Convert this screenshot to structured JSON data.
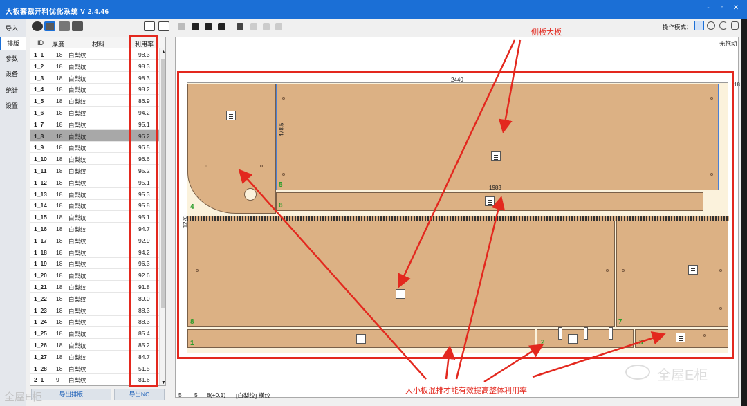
{
  "app": {
    "title": "大板套裁开料优化系统 V 2.4.46",
    "window_buttons": [
      "-",
      "▫",
      "✕"
    ]
  },
  "nav": [
    "导入",
    "排版",
    "参数",
    "设备",
    "统计",
    "设置"
  ],
  "grid": {
    "headers": [
      "ID",
      "厚度",
      "材料",
      "利用率"
    ],
    "rows": [
      [
        "1_1",
        "18",
        "白梨纹",
        "98.3"
      ],
      [
        "1_2",
        "18",
        "白梨纹",
        "98.3"
      ],
      [
        "1_3",
        "18",
        "白梨纹",
        "98.3"
      ],
      [
        "1_4",
        "18",
        "白梨纹",
        "98.2"
      ],
      [
        "1_5",
        "18",
        "白梨纹",
        "86.9"
      ],
      [
        "1_6",
        "18",
        "白梨纹",
        "94.2"
      ],
      [
        "1_7",
        "18",
        "白梨纹",
        "95.1"
      ],
      [
        "1_8",
        "18",
        "白梨纹",
        "96.2"
      ],
      [
        "1_9",
        "18",
        "白梨纹",
        "96.5"
      ],
      [
        "1_10",
        "18",
        "白梨纹",
        "96.6"
      ],
      [
        "1_11",
        "18",
        "白梨纹",
        "95.2"
      ],
      [
        "1_12",
        "18",
        "白梨纹",
        "95.1"
      ],
      [
        "1_13",
        "18",
        "白梨纹",
        "95.3"
      ],
      [
        "1_14",
        "18",
        "白梨纹",
        "95.8"
      ],
      [
        "1_15",
        "18",
        "白梨纹",
        "95.1"
      ],
      [
        "1_16",
        "18",
        "白梨纹",
        "94.7"
      ],
      [
        "1_17",
        "18",
        "白梨纹",
        "92.9"
      ],
      [
        "1_18",
        "18",
        "白梨纹",
        "94.2"
      ],
      [
        "1_19",
        "18",
        "白梨纹",
        "96.3"
      ],
      [
        "1_20",
        "18",
        "白梨纹",
        "92.6"
      ],
      [
        "1_21",
        "18",
        "白梨纹",
        "91.8"
      ],
      [
        "1_22",
        "18",
        "白梨纹",
        "89.0"
      ],
      [
        "1_23",
        "18",
        "白梨纹",
        "88.3"
      ],
      [
        "1_24",
        "18",
        "白梨纹",
        "88.3"
      ],
      [
        "1_25",
        "18",
        "白梨纹",
        "85.4"
      ],
      [
        "1_26",
        "18",
        "白梨纹",
        "85.2"
      ],
      [
        "1_27",
        "18",
        "白梨纹",
        "84.7"
      ],
      [
        "1_28",
        "18",
        "白梨纹",
        "51.5"
      ],
      [
        "2_1",
        "9",
        "白梨纹",
        "81.6"
      ]
    ],
    "selected_row": "1_8"
  },
  "buttons": {
    "left": "导出排版",
    "export_nc": "导出NC"
  },
  "toolbar": {
    "mode_label": "操作模式："
  },
  "canvas": {
    "drag_status": "无拖动",
    "board_width": "2440",
    "board_height": "1220",
    "thickness": "18",
    "dim_a": "478.5",
    "dim_b": "1983",
    "piece_numbers": [
      "4",
      "5",
      "6",
      "8",
      "1",
      "2",
      "7",
      "3"
    ]
  },
  "annotations": {
    "top": "侧板大板",
    "bottom": "大小板混排才能有效提高整体利用率"
  },
  "status": {
    "a": "5",
    "b": "5",
    "c": "8(+0.1)",
    "material": "[白梨纹]",
    "grain": "横纹"
  },
  "watermark": {
    "left": "全屋E柜",
    "brand": "全屋E柜"
  },
  "colors": {
    "accent": "#1b6fd6",
    "highlight": "#e3281e",
    "board": "#dcb184"
  }
}
